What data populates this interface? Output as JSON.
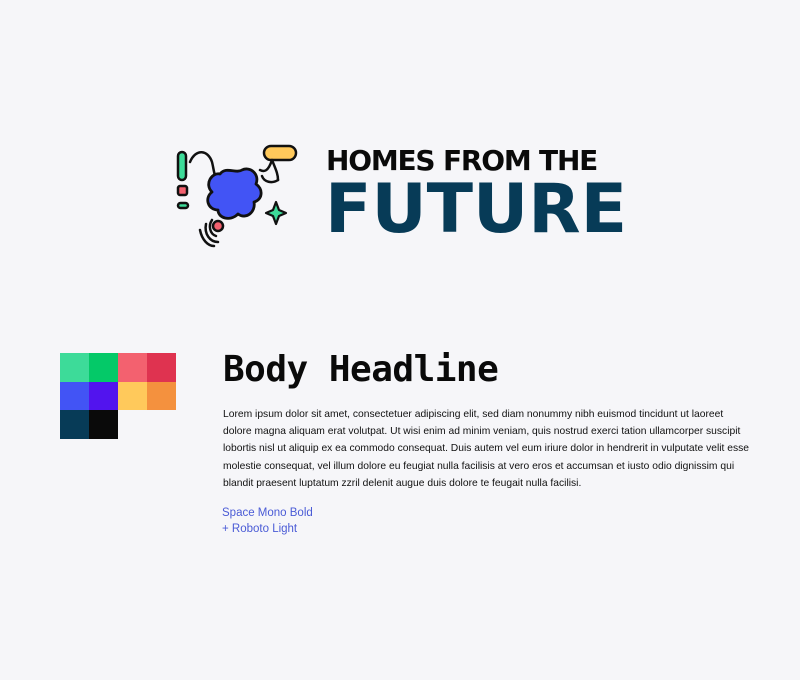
{
  "brand": {
    "line1": "HOMES FROM THE",
    "line2": "FUTURE",
    "icon_name": "robot-vacuum-splash-icon",
    "colors": {
      "line1": "#0a0a0a",
      "line2": "#073b57"
    }
  },
  "palette": {
    "swatches": [
      {
        "name": "mint",
        "color": "#3ddb99"
      },
      {
        "name": "green",
        "color": "#04c968"
      },
      {
        "name": "pink",
        "color": "#f3616f"
      },
      {
        "name": "red",
        "color": "#df3350"
      },
      {
        "name": "blue",
        "color": "#4254f5"
      },
      {
        "name": "violet",
        "color": "#5214ee"
      },
      {
        "name": "yellow",
        "color": "#ffc95b"
      },
      {
        "name": "orange",
        "color": "#f4913e"
      },
      {
        "name": "navy",
        "color": "#073b57"
      },
      {
        "name": "black",
        "color": "#0a0a0a"
      }
    ]
  },
  "typography": {
    "headline": "Body Headline",
    "body": "Lorem ipsum dolor sit amet, consectetuer adipiscing elit, sed diam nonummy nibh euismod tincidunt ut laoreet dolore magna aliquam erat volutpat. Ut wisi enim ad minim veniam, quis nostrud exerci tation ullamcorper suscipit lobortis nisl ut aliquip ex ea commodo consequat. Duis autem vel eum iriure dolor in hendrerit in vulputate velit esse molestie consequat, vel illum dolore eu feugiat nulla facilisis at vero eros et accumsan et iusto odio dignissim qui blandit praesent luptatum zzril delenit augue duis dolore te feugait nulla facilisi.",
    "font_note_line1": "Space Mono Bold",
    "font_note_line2": "+ Roboto Light",
    "accent_color": "#4a5bd6"
  }
}
